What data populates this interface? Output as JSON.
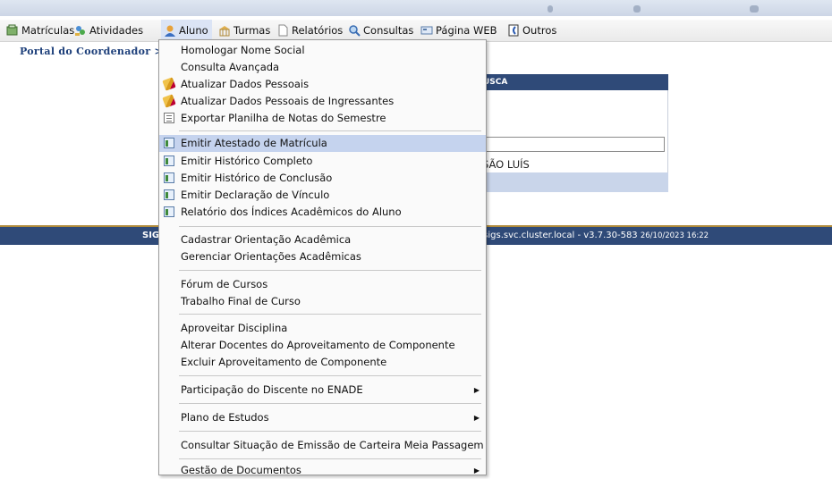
{
  "menubar": {
    "items": [
      {
        "label": "Matrículas",
        "icon": "matriculas-icon"
      },
      {
        "label": "Atividades",
        "icon": "atividades-icon"
      },
      {
        "label": "Aluno",
        "icon": "aluno-icon"
      },
      {
        "label": "Turmas",
        "icon": "turmas-icon"
      },
      {
        "label": "Relatórios",
        "icon": "relatorios-icon"
      },
      {
        "label": "Consultas",
        "icon": "consultas-icon"
      },
      {
        "label": "Página WEB",
        "icon": "pagina-web-icon"
      },
      {
        "label": "Outros",
        "icon": "outros-icon"
      }
    ]
  },
  "breadcrumb": {
    "text": "Portal do Coordenador >"
  },
  "panel": {
    "header": "USCA",
    "text": "SÃO LUÍS"
  },
  "footer": {
    "left": "SIG",
    "right": ".sigs.svc.cluster.local - v3.7.30-583",
    "timestamp": "26/10/2023 16:22"
  },
  "dropdown": {
    "items": [
      {
        "label": "Homologar Nome Social"
      },
      {
        "label": "Consulta Avançada"
      },
      {
        "label": "Atualizar Dados Pessoais",
        "icon": "pencil-icon"
      },
      {
        "label": "Atualizar Dados Pessoais de Ingressantes",
        "icon": "pencil-icon"
      },
      {
        "label": "Exportar Planilha de Notas do Semestre",
        "icon": "spreadsheet-icon"
      },
      {
        "label": "Emitir Atestado de Matrícula",
        "icon": "document-icon",
        "highlighted": true
      },
      {
        "label": "Emitir Histórico Completo",
        "icon": "document-icon"
      },
      {
        "label": "Emitir Histórico de Conclusão",
        "icon": "document-icon"
      },
      {
        "label": "Emitir Declaração de Vínculo",
        "icon": "document-icon"
      },
      {
        "label": "Relatório dos Índices Acadêmicos do Aluno",
        "icon": "document-icon"
      },
      {
        "label": "Cadastrar Orientação Acadêmica"
      },
      {
        "label": "Gerenciar Orientações Acadêmicas"
      },
      {
        "label": "Fórum de Cursos"
      },
      {
        "label": "Trabalho Final de Curso"
      },
      {
        "label": "Aproveitar Disciplina"
      },
      {
        "label": "Alterar Docentes do Aproveitamento de Componente"
      },
      {
        "label": "Excluir Aproveitamento de Componente"
      },
      {
        "label": "Participação do Discente no ENADE",
        "submenu": true
      },
      {
        "label": "Plano de Estudos",
        "submenu": true
      },
      {
        "label": "Consultar Situação de Emissão de Carteira Meia Passagem"
      },
      {
        "label": "Gestão de Documentos",
        "submenu": true
      }
    ]
  },
  "colors": {
    "header_blue": "#2f4a78",
    "highlight": "#c5d3ee",
    "accent_gold": "#b08b3c"
  }
}
